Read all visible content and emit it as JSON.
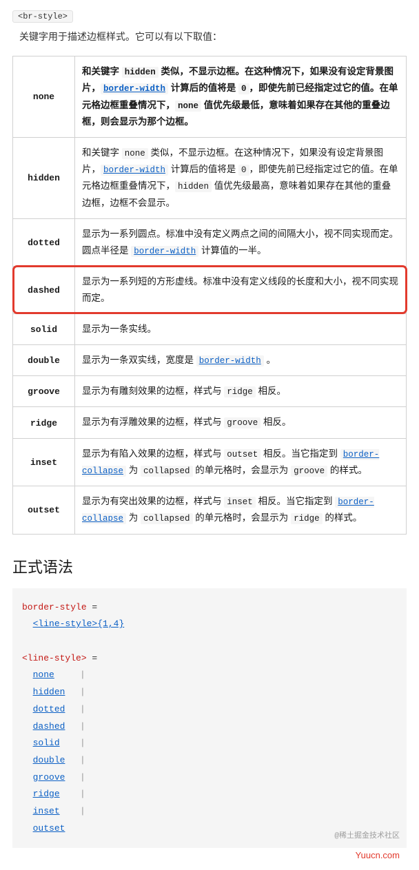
{
  "tag": "<br-style>",
  "desc": "关键字用于描述边框样式。它可以有以下取值：",
  "rows": [
    {
      "key": "none",
      "html": "和关键字 <code>hidden</code> 类似，不显示边框。在这种情况下，如果没有设定背景图片，<span class=\"link\">border-width</span> 计算后的值将是 <code>0</code>，即使先前已经指定过它的值。在单元格边框重叠情况下，<code>none</code> 值优先级最低，意味着如果存在其他的重叠边框，则会显示为那个边框。",
      "bold": true
    },
    {
      "key": "hidden",
      "html": "和关键字 <code>none</code> 类似，不显示边框。在这种情况下，如果没有设定背景图片，<span class=\"link\">border-width</span> 计算后的值将是 <code>0</code>，即使先前已经指定过它的值。在单元格边框重叠情况下，<code>hidden</code> 值优先级最高，意味着如果存在其他的重叠边框，边框不会显示。"
    },
    {
      "key": "dotted",
      "html": "显示为一系列圆点。标准中没有定义两点之间的间隔大小，视不同实现而定。圆点半径是 <span class=\"link\">border-width</span> 计算值的一半。"
    },
    {
      "key": "dashed",
      "html": "显示为一系列短的方形虚线。标准中没有定义线段的长度和大小，视不同实现而定。",
      "highlight": true
    },
    {
      "key": "solid",
      "html": "显示为一条实线。"
    },
    {
      "key": "double",
      "html": "显示为一条双实线，宽度是 <span class=\"link\">border-width</span> 。"
    },
    {
      "key": "groove",
      "html": "显示为有雕刻效果的边框，样式与 <code>ridge</code> 相反。"
    },
    {
      "key": "ridge",
      "html": "显示为有浮雕效果的边框，样式与 <code>groove</code> 相反。"
    },
    {
      "key": "inset",
      "html": "显示为有陷入效果的边框，样式与 <code>outset</code> 相反。当它指定到 <span class=\"link\">border-collapse</span> 为 <code>collapsed</code> 的单元格时，会显示为 <code>groove</code> 的样式。"
    },
    {
      "key": "outset",
      "html": "显示为有突出效果的边框，样式与 <code>inset</code> 相反。当它指定到 <span class=\"link\">border-collapse</span> 为 <code>collapsed</code> 的单元格时，会显示为 <code>ridge</code> 的样式。"
    }
  ],
  "syntax_heading": "正式语法",
  "syntax": {
    "prop1": "border-style",
    "eq": " = ",
    "line_style_ref": "<line-style>",
    "mult": "{1,4}",
    "prop2": "<line-style>",
    "options": [
      "none",
      "hidden",
      "dotted",
      "dashed",
      "solid",
      "double",
      "groove",
      "ridge",
      "inset",
      "outset"
    ]
  },
  "credit": "@稀土掘金技术社区",
  "watermark": "Yuucn.com"
}
